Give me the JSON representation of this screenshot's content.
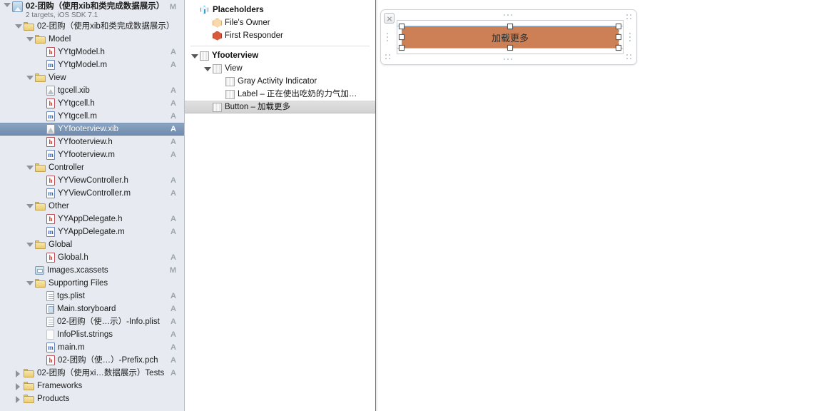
{
  "app": {
    "name": "Xcode Interface Builder"
  },
  "navigator": {
    "project": {
      "title": "02-团购（使用xib和类完成数据展示）",
      "subtitle": "2 targets, iOS SDK 7.1",
      "status": "M",
      "icon": "xcode-project-icon"
    },
    "items": [
      {
        "label": "02-团购（使用xib和类完成数据展示）",
        "icon": "folder-icon",
        "indent": 1,
        "twisty": "open",
        "status": ""
      },
      {
        "label": "Model",
        "icon": "folder-icon",
        "indent": 2,
        "twisty": "open",
        "status": ""
      },
      {
        "label": "YYtgModel.h",
        "icon": "header-file-icon",
        "indent": 3,
        "twisty": "none",
        "status": "A"
      },
      {
        "label": "YYtgModel.m",
        "icon": "method-file-icon",
        "indent": 3,
        "twisty": "none",
        "status": "A"
      },
      {
        "label": "View",
        "icon": "folder-icon",
        "indent": 2,
        "twisty": "open",
        "status": ""
      },
      {
        "label": "tgcell.xib",
        "icon": "xib-file-icon",
        "indent": 3,
        "twisty": "none",
        "status": "A"
      },
      {
        "label": "YYtgcell.h",
        "icon": "header-file-icon",
        "indent": 3,
        "twisty": "none",
        "status": "A"
      },
      {
        "label": "YYtgcell.m",
        "icon": "method-file-icon",
        "indent": 3,
        "twisty": "none",
        "status": "A"
      },
      {
        "label": "YYfooterview.xib",
        "icon": "xib-file-icon",
        "indent": 3,
        "twisty": "none",
        "status": "A",
        "selected": true
      },
      {
        "label": "YYfooterview.h",
        "icon": "header-file-icon",
        "indent": 3,
        "twisty": "none",
        "status": "A"
      },
      {
        "label": "YYfooterview.m",
        "icon": "method-file-icon",
        "indent": 3,
        "twisty": "none",
        "status": "A"
      },
      {
        "label": "Controller",
        "icon": "folder-icon",
        "indent": 2,
        "twisty": "open",
        "status": ""
      },
      {
        "label": "YYViewController.h",
        "icon": "header-file-icon",
        "indent": 3,
        "twisty": "none",
        "status": "A"
      },
      {
        "label": "YYViewController.m",
        "icon": "method-file-icon",
        "indent": 3,
        "twisty": "none",
        "status": "A"
      },
      {
        "label": "Other",
        "icon": "folder-icon",
        "indent": 2,
        "twisty": "open",
        "status": ""
      },
      {
        "label": "YYAppDelegate.h",
        "icon": "header-file-icon",
        "indent": 3,
        "twisty": "none",
        "status": "A"
      },
      {
        "label": "YYAppDelegate.m",
        "icon": "method-file-icon",
        "indent": 3,
        "twisty": "none",
        "status": "A"
      },
      {
        "label": "Global",
        "icon": "folder-icon",
        "indent": 2,
        "twisty": "open",
        "status": ""
      },
      {
        "label": "Global.h",
        "icon": "header-file-icon",
        "indent": 3,
        "twisty": "none",
        "status": "A"
      },
      {
        "label": "Images.xcassets",
        "icon": "xcassets-icon",
        "indent": 2,
        "twisty": "none",
        "status": "M"
      },
      {
        "label": "Supporting Files",
        "icon": "folder-icon",
        "indent": 2,
        "twisty": "open",
        "status": ""
      },
      {
        "label": "tgs.plist",
        "icon": "plist-file-icon",
        "indent": 3,
        "twisty": "none",
        "status": "A"
      },
      {
        "label": "Main.storyboard",
        "icon": "storyboard-file-icon",
        "indent": 3,
        "twisty": "none",
        "status": "A"
      },
      {
        "label": "02-团购（使…示）-Info.plist",
        "icon": "plist-file-icon",
        "indent": 3,
        "twisty": "none",
        "status": "A"
      },
      {
        "label": "InfoPlist.strings",
        "icon": "strings-file-icon",
        "indent": 3,
        "twisty": "none",
        "status": "A"
      },
      {
        "label": "main.m",
        "icon": "method-file-icon",
        "indent": 3,
        "twisty": "none",
        "status": "A"
      },
      {
        "label": "02-团购（使…）-Prefix.pch",
        "icon": "header-file-icon",
        "indent": 3,
        "twisty": "none",
        "status": "A"
      },
      {
        "label": "02-团购（使用xi…数据展示）Tests",
        "icon": "folder-icon",
        "indent": 1,
        "twisty": "closed",
        "status": "A"
      },
      {
        "label": "Frameworks",
        "icon": "folder-icon",
        "indent": 1,
        "twisty": "closed",
        "status": ""
      },
      {
        "label": "Products",
        "icon": "folder-icon",
        "indent": 1,
        "twisty": "closed",
        "status": ""
      }
    ]
  },
  "outline": {
    "items": [
      {
        "label": "Placeholders",
        "icon": "cube-icon",
        "indent": 0,
        "twisty": "none",
        "bold": true
      },
      {
        "label": "File's Owner",
        "icon": "files-owner-icon",
        "indent": 1,
        "twisty": "none",
        "bold": false
      },
      {
        "label": "First Responder",
        "icon": "first-responder-icon",
        "indent": 1,
        "twisty": "none",
        "bold": false
      },
      {
        "label": "Yfooterview",
        "icon": "object-icon",
        "indent": 0,
        "twisty": "open",
        "bold": true
      },
      {
        "label": "View",
        "icon": "object-icon",
        "indent": 1,
        "twisty": "open",
        "bold": false
      },
      {
        "label": "Gray Activity Indicator",
        "icon": "object-icon",
        "indent": 2,
        "twisty": "none",
        "bold": false
      },
      {
        "label": "Label – 正在使出吃奶的力气加…",
        "icon": "object-icon",
        "indent": 2,
        "twisty": "none",
        "bold": false
      },
      {
        "label": "Button – 加载更多",
        "icon": "object-icon",
        "indent": 1,
        "twisty": "none",
        "bold": false,
        "selected": true
      }
    ]
  },
  "canvas": {
    "button": {
      "label": "加载更多",
      "color": "#cd8056",
      "text_color": "#2b2b2b"
    },
    "scene_close_icon": "close-icon"
  }
}
